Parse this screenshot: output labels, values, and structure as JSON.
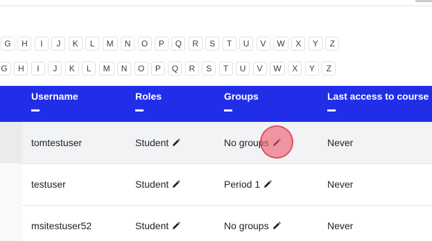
{
  "letter_filters": {
    "first_name": [
      "G",
      "H",
      "I",
      "J",
      "K",
      "L",
      "M",
      "N",
      "O",
      "P",
      "Q",
      "R",
      "S",
      "T",
      "U",
      "V",
      "W",
      "X",
      "Y",
      "Z"
    ],
    "last_name": [
      "G",
      "H",
      "I",
      "J",
      "K",
      "L",
      "M",
      "N",
      "O",
      "P",
      "Q",
      "R",
      "S",
      "T",
      "U",
      "V",
      "W",
      "X",
      "Y",
      "Z"
    ]
  },
  "table": {
    "headers": {
      "username": "Username",
      "roles": "Roles",
      "groups": "Groups",
      "last_access": "Last access to course"
    },
    "rows": [
      {
        "username": "tomtestuser",
        "roles": "Student",
        "groups": "No groups",
        "last_access": "Never"
      },
      {
        "username": "testuser",
        "roles": "Student",
        "groups": "Period 1",
        "last_access": "Never"
      },
      {
        "username": "msitestuser52",
        "roles": "Student",
        "groups": "No groups",
        "last_access": "Never"
      }
    ]
  },
  "colors": {
    "header_background": "#212ee8",
    "header_text": "#ffffff",
    "row_highlight": "#f2f3f4",
    "click_marker": "#ec5a6e"
  },
  "icons": {
    "edit": "pencil-icon"
  }
}
